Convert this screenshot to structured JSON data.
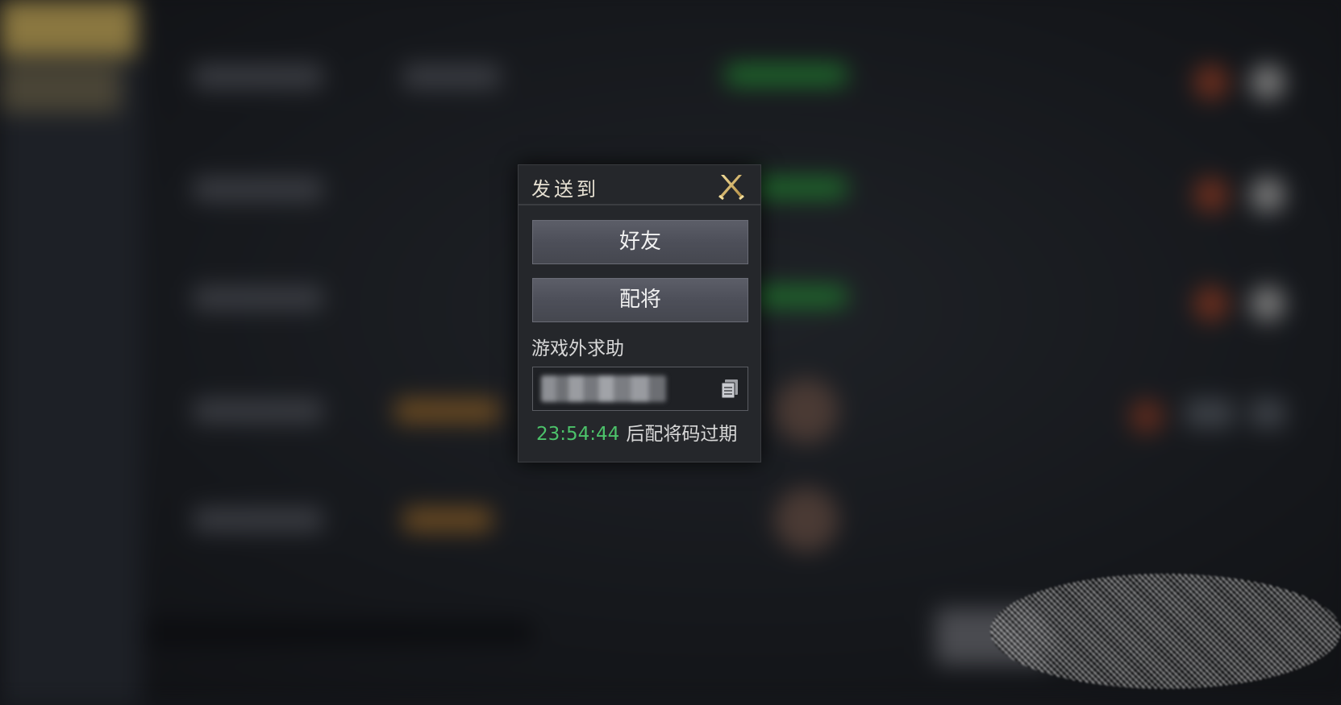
{
  "dialog": {
    "title": "发送到",
    "close_icon": "close-icon",
    "buttons": [
      {
        "label": "好友"
      },
      {
        "label": "配将"
      }
    ],
    "help_label": "游戏外求助",
    "code_field": {
      "value": "",
      "copy_icon": "copy-icon"
    },
    "expire": {
      "time": "23:54:44",
      "text": "后配将码过期"
    }
  },
  "colors": {
    "dialog_bg": "#25272b",
    "button_bg": "#55575f",
    "title_text": "#e6e0d2",
    "timer_green": "#4cc26a",
    "close_gold": "#d6b46a"
  }
}
